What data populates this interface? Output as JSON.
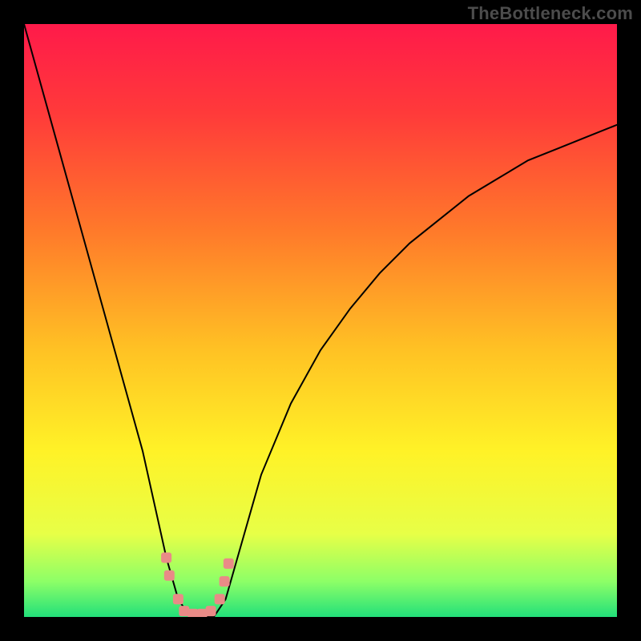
{
  "watermark": "TheBottleneck.com",
  "chart_data": {
    "type": "line",
    "title": "",
    "xlabel": "",
    "ylabel": "",
    "x": [
      0.0,
      0.05,
      0.1,
      0.15,
      0.2,
      0.24,
      0.26,
      0.28,
      0.3,
      0.32,
      0.34,
      0.36,
      0.4,
      0.45,
      0.5,
      0.55,
      0.6,
      0.65,
      0.7,
      0.75,
      0.8,
      0.85,
      0.9,
      0.95,
      1.0
    ],
    "values": [
      1.0,
      0.82,
      0.64,
      0.46,
      0.28,
      0.1,
      0.03,
      0.0,
      0.0,
      0.0,
      0.03,
      0.1,
      0.24,
      0.36,
      0.45,
      0.52,
      0.58,
      0.63,
      0.67,
      0.71,
      0.74,
      0.77,
      0.79,
      0.81,
      0.83
    ],
    "ylim": [
      0,
      1
    ],
    "xlim": [
      0,
      1
    ],
    "gradient_stops": [
      {
        "offset": 0.0,
        "color": "#ff1a4a"
      },
      {
        "offset": 0.15,
        "color": "#ff3a3a"
      },
      {
        "offset": 0.35,
        "color": "#ff7a2a"
      },
      {
        "offset": 0.55,
        "color": "#ffc224"
      },
      {
        "offset": 0.72,
        "color": "#fff227"
      },
      {
        "offset": 0.86,
        "color": "#e7ff47"
      },
      {
        "offset": 0.94,
        "color": "#8dff67"
      },
      {
        "offset": 1.0,
        "color": "#22e07a"
      }
    ],
    "curve_color": "#000000",
    "marker_color": "#e98b87",
    "markers": [
      {
        "x": 0.24,
        "y": 0.1
      },
      {
        "x": 0.245,
        "y": 0.07
      },
      {
        "x": 0.26,
        "y": 0.03
      },
      {
        "x": 0.27,
        "y": 0.01
      },
      {
        "x": 0.285,
        "y": 0.005
      },
      {
        "x": 0.3,
        "y": 0.005
      },
      {
        "x": 0.315,
        "y": 0.01
      },
      {
        "x": 0.33,
        "y": 0.03
      },
      {
        "x": 0.338,
        "y": 0.06
      },
      {
        "x": 0.345,
        "y": 0.09
      }
    ]
  }
}
